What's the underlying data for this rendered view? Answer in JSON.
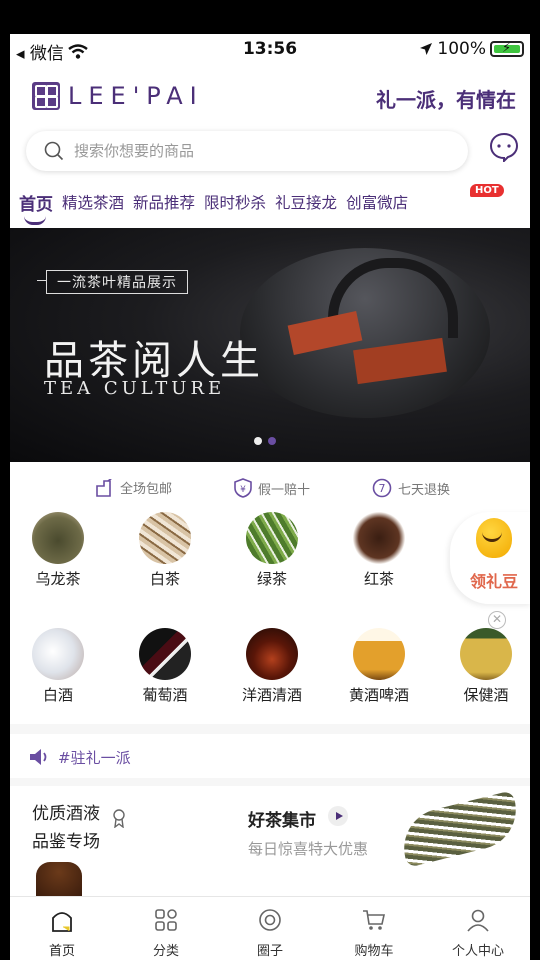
{
  "status_bar": {
    "back_app": "◂ 微信",
    "time": "13:56",
    "battery": "100%"
  },
  "header": {
    "brand": "LEE'PAI",
    "slogan": "礼一派，有情在"
  },
  "search": {
    "placeholder": "搜索你想要的商品"
  },
  "tabs": [
    {
      "label": "首页"
    },
    {
      "label": "精选茶酒"
    },
    {
      "label": "新品推荐"
    },
    {
      "label": "限时秒杀"
    },
    {
      "label": "礼豆接龙"
    },
    {
      "label": "创富微店"
    }
  ],
  "hot_badge": "HOT",
  "banner": {
    "tag": "一流茶叶精品展示",
    "title": "品茶阅人生",
    "subtitle": "TEA CULTURE",
    "active_dot": 2,
    "dot_count": 2
  },
  "services": [
    {
      "label": "全场包邮",
      "icon": "delivery-icon"
    },
    {
      "label": "假一赔十",
      "icon": "shield-icon"
    },
    {
      "label": "七天退换",
      "icon": "seven-days-icon"
    }
  ],
  "categories_row1": [
    {
      "label": "乌龙茶"
    },
    {
      "label": "白茶"
    },
    {
      "label": "绿茶"
    },
    {
      "label": "红茶"
    }
  ],
  "categories_row2": [
    {
      "label": "白酒"
    },
    {
      "label": "葡萄酒"
    },
    {
      "label": "洋酒清酒"
    },
    {
      "label": "黄酒啤酒"
    },
    {
      "label": "保健酒"
    }
  ],
  "float_widget": {
    "label": "领礼豆"
  },
  "notice": {
    "text": "#驻礼一派"
  },
  "promo_left": {
    "line1": "优质酒液",
    "line2": "品鉴专场"
  },
  "promo_right": {
    "title": "好茶集市",
    "subtitle": "每日惊喜特大优惠"
  },
  "tabbar": [
    {
      "label": "首页",
      "icon": "home-icon"
    },
    {
      "label": "分类",
      "icon": "category-icon"
    },
    {
      "label": "圈子",
      "icon": "circle-icon"
    },
    {
      "label": "购物车",
      "icon": "cart-icon"
    },
    {
      "label": "个人中心",
      "icon": "profile-icon"
    }
  ],
  "colors": {
    "brand": "#4b2f78",
    "accent": "#6a4ea2",
    "hot": "#e83030"
  }
}
